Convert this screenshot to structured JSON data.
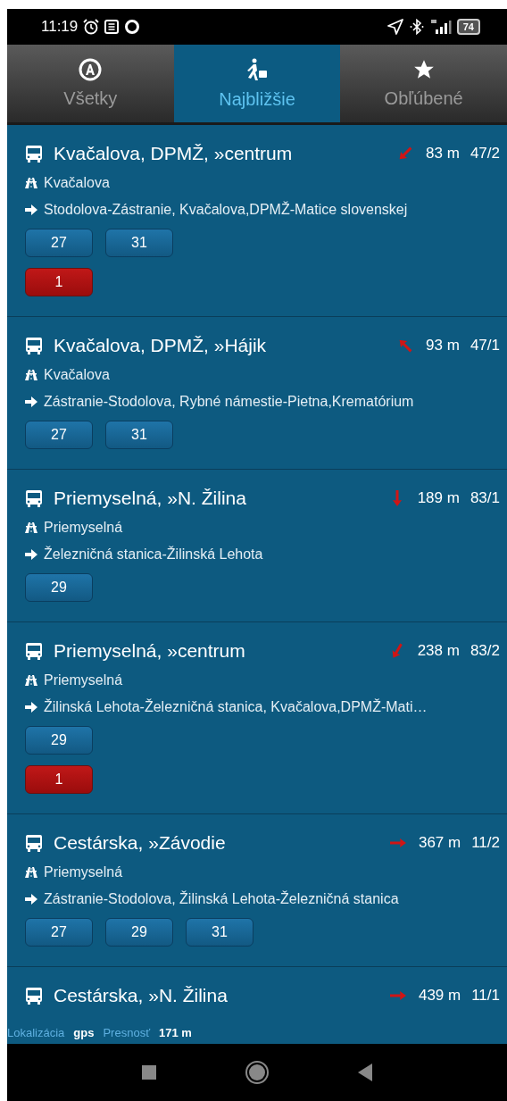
{
  "status_bar": {
    "time": "11:19",
    "battery": "74"
  },
  "tabs": [
    {
      "label": "Všetky",
      "selected": false
    },
    {
      "label": "Najbližšie",
      "selected": true
    },
    {
      "label": "Obľúbené",
      "selected": false
    }
  ],
  "stops": [
    {
      "name": "Kvačalova, DPMŽ, »centrum",
      "distance": "83 m",
      "code": "47/2",
      "street": "Kvačalova",
      "route": "Stodolova-Zástranie, Kvačalova,DPMŽ-Matice slovenskej",
      "lines": [
        {
          "number": "27",
          "kind": "day"
        },
        {
          "number": "31",
          "kind": "day"
        }
      ],
      "night_lines": [
        {
          "number": "1",
          "kind": "night"
        }
      ]
    },
    {
      "name": "Kvačalova, DPMŽ, »Hájik",
      "distance": "93 m",
      "code": "47/1",
      "street": "Kvačalova",
      "route": "Zástranie-Stodolova, Rybné námestie-Pietna,Krematórium",
      "lines": [
        {
          "number": "27",
          "kind": "day"
        },
        {
          "number": "31",
          "kind": "day"
        }
      ]
    },
    {
      "name": "Priemyselná, »N. Žilina",
      "distance": "189 m",
      "code": "83/1",
      "street": "Priemyselná",
      "route": "Železničná stanica-Žilinská Lehota",
      "lines": [
        {
          "number": "29",
          "kind": "day"
        }
      ]
    },
    {
      "name": "Priemyselná, »centrum",
      "distance": "238 m",
      "code": "83/2",
      "street": "Priemyselná",
      "route": "Žilinská Lehota-Železničná stanica, Kvačalova,DPMŽ-Mati…",
      "lines": [
        {
          "number": "29",
          "kind": "day"
        }
      ],
      "night_lines": [
        {
          "number": "1",
          "kind": "night"
        }
      ]
    },
    {
      "name": "Cestárska, »Závodie",
      "distance": "367 m",
      "code": "11/2",
      "street": "Priemyselná",
      "route": "Zástranie-Stodolova, Žilinská Lehota-Železničná stanica",
      "lines": [
        {
          "number": "27",
          "kind": "day"
        },
        {
          "number": "29",
          "kind": "day"
        },
        {
          "number": "31",
          "kind": "day"
        }
      ]
    },
    {
      "name": "Cestárska, »N. Žilina",
      "distance": "439 m",
      "code": "11/1"
    }
  ],
  "footer": {
    "location_label": "Lokalizácia",
    "location_value": "gps",
    "accuracy_label": "Presnosť",
    "accuracy_value": "171 m"
  }
}
